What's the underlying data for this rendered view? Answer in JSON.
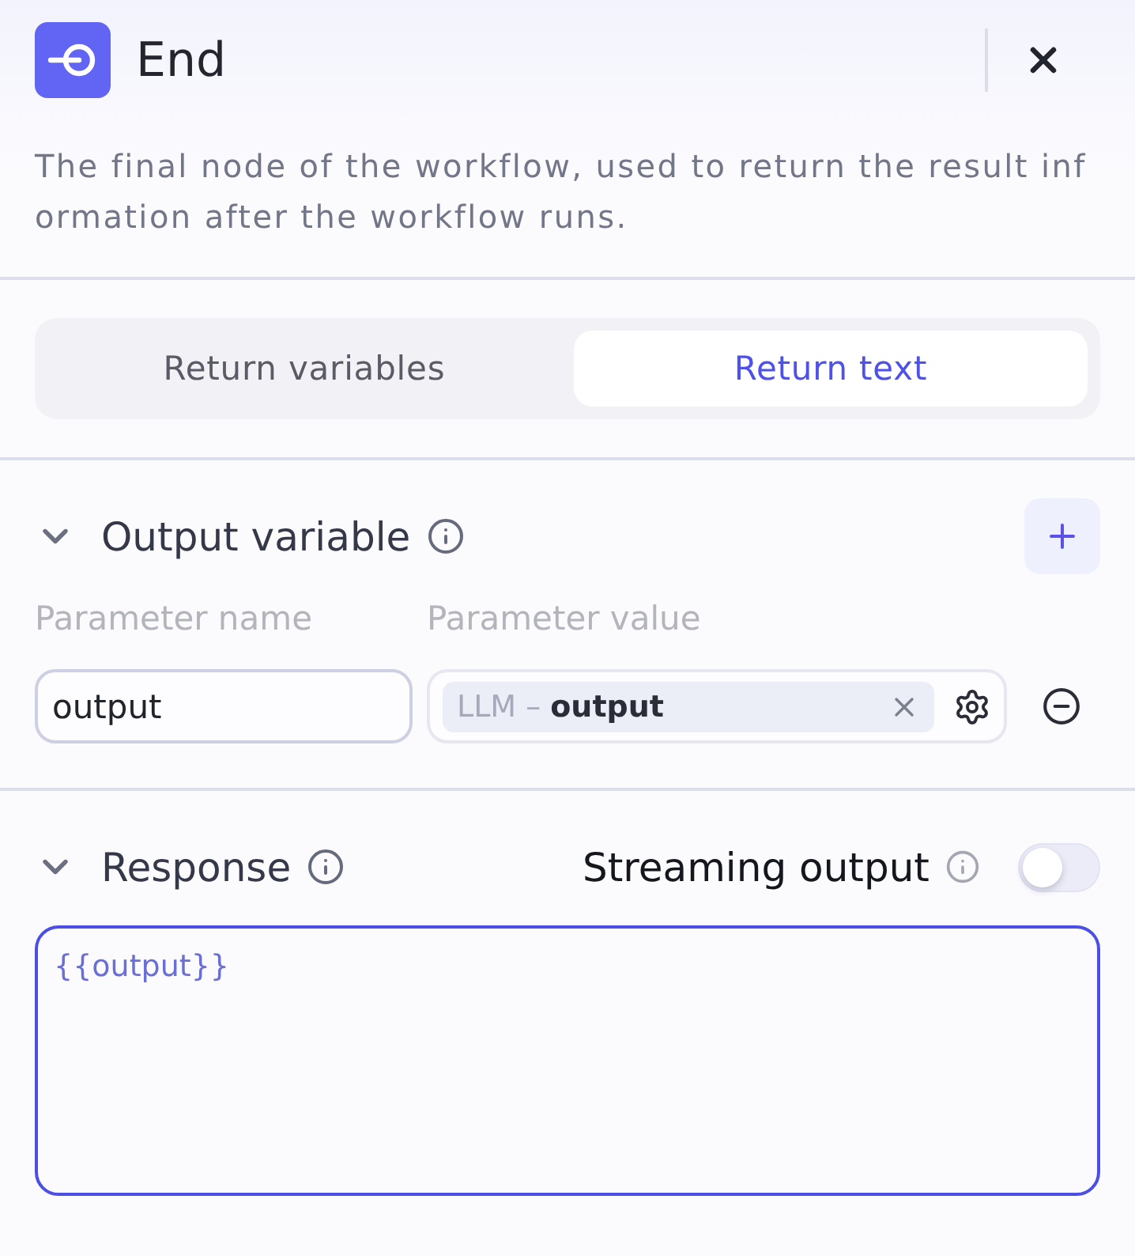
{
  "header": {
    "title": "End",
    "description": "The final node of the workflow, used to return the result information after the workflow runs."
  },
  "tabs": [
    {
      "label": "Return variables",
      "selected": false
    },
    {
      "label": "Return text",
      "selected": true
    }
  ],
  "output_variable": {
    "title": "Output variable",
    "expanded": true,
    "columns": [
      "Parameter name",
      "Parameter value"
    ],
    "rows": [
      {
        "name": "output",
        "value_prefix": "LLM –",
        "value_name": "output"
      }
    ]
  },
  "response": {
    "title": "Response",
    "expanded": true,
    "streaming": {
      "label": "Streaming output",
      "on": false
    },
    "template": "{{output}}"
  }
}
